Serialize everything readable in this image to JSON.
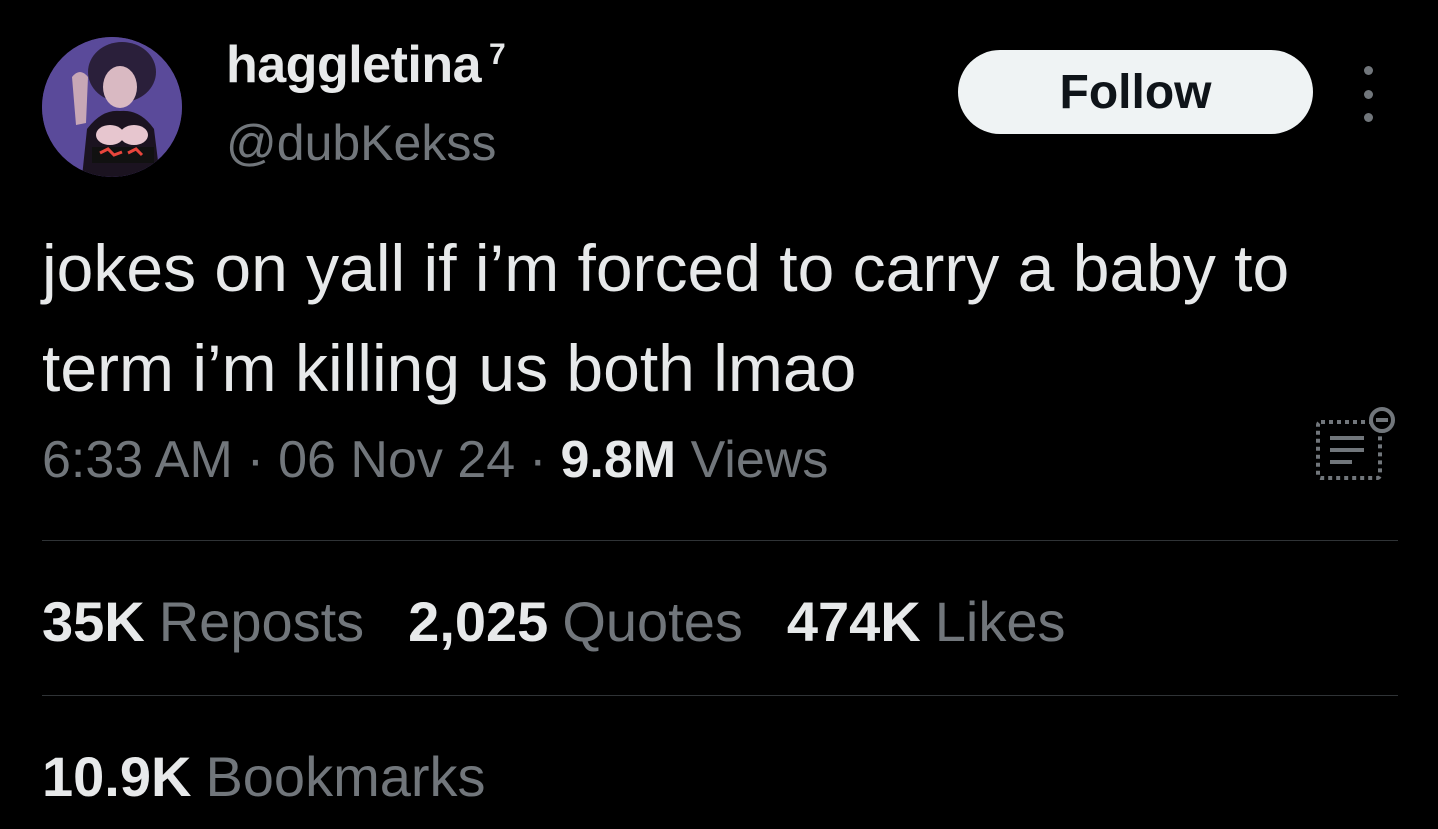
{
  "author": {
    "display_name": "haggletina",
    "name_suffix": "7",
    "handle": "@dubKekss"
  },
  "actions": {
    "follow_label": "Follow"
  },
  "tweet": {
    "text": "jokes on yall if i’m forced to carry a baby to term i’m killing us both lmao",
    "time": "6:33 AM",
    "date": "06 Nov 24",
    "separator": "·",
    "views_count": "9.8M",
    "views_label": "Views"
  },
  "stats": [
    {
      "count": "35K",
      "label": "Reposts"
    },
    {
      "count": "2,025",
      "label": "Quotes"
    },
    {
      "count": "474K",
      "label": "Likes"
    }
  ],
  "bookmarks": {
    "count": "10.9K",
    "label": "Bookmarks"
  },
  "icons": {
    "more": "more-vertical-icon",
    "analytics": "post-analytics-icon"
  },
  "colors": {
    "background": "#000000",
    "primary_text": "#e7e9ea",
    "secondary_text": "#71767b",
    "divider": "#2f3336",
    "follow_button_bg": "#eff3f4",
    "follow_button_text": "#0f1419"
  }
}
